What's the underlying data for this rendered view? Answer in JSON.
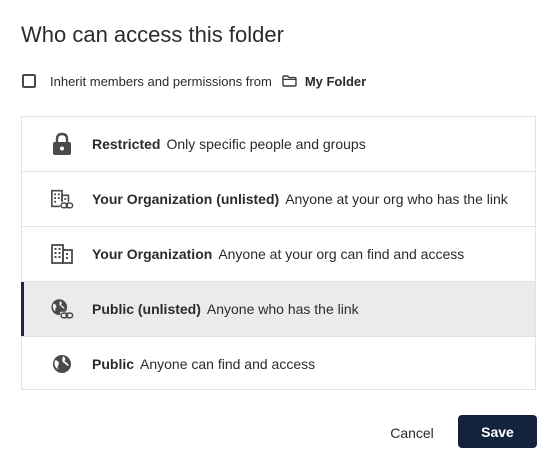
{
  "dialog": {
    "title": "Who can access this folder",
    "inherit": {
      "label": "Inherit members and permissions from",
      "folder_icon": "folder-icon",
      "folder_name": "My Folder",
      "checked": false
    },
    "options": [
      {
        "icon": "lock-icon",
        "name": "Restricted",
        "description": "Only specific people and groups",
        "selected": false
      },
      {
        "icon": "building-link-icon",
        "name": "Your Organization (unlisted)",
        "description": "Anyone at your org who has the link",
        "selected": false
      },
      {
        "icon": "building-icon",
        "name": "Your Organization",
        "description": "Anyone at your org can find and access",
        "selected": false
      },
      {
        "icon": "globe-link-icon",
        "name": "Public (unlisted)",
        "description": "Anyone who has the link",
        "selected": true
      },
      {
        "icon": "globe-icon",
        "name": "Public",
        "description": "Anyone can find and access",
        "selected": false
      }
    ],
    "buttons": {
      "cancel_label": "Cancel",
      "save_label": "Save"
    }
  },
  "colors": {
    "primary": "#14233d",
    "selected_bg": "#ebebeb",
    "border": "#e3e3e3",
    "text": "#2b2b2b"
  }
}
